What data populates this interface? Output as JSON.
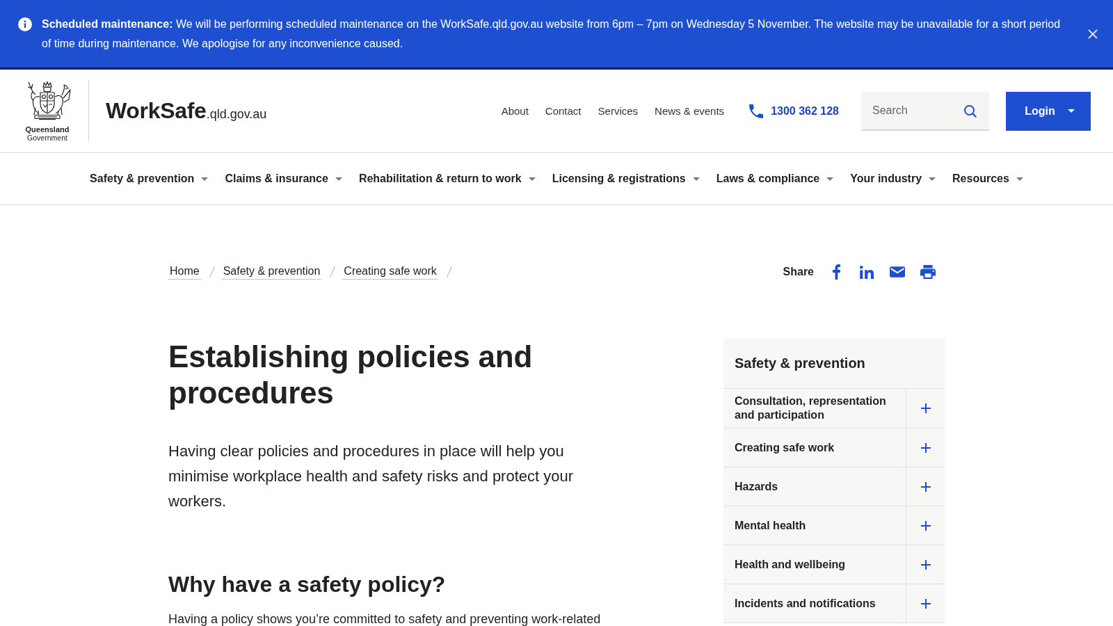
{
  "alert": {
    "message": "**Scheduled maintenance:** We will be performing scheduled maintenance on the WorkSafe.qld.gov.au website from 6pm – 7pm on Wednesday 5 November. The website may be unavailable for a short period of time during maintenance. We apologise for any inconvenience caused."
  },
  "header": {
    "logo": {
      "line_1": "Queensland",
      "line_2": "Government"
    },
    "site_name": {
      "name": "WorkSafe",
      "domain": ".qld.gov.au"
    },
    "links": [
      "About",
      "Contact",
      "Services",
      "News & events"
    ],
    "phone": "1300 362 128",
    "search": {
      "placeholder": "Search"
    },
    "login": {
      "label": "Login"
    }
  },
  "main_nav": [
    "Safety & prevention",
    "Claims & insurance",
    "Rehabilitation & return to work",
    "Licensing & registrations",
    "Laws & compliance",
    "Your industry",
    "Resources"
  ],
  "breadcrumb": [
    "Home",
    "Safety & prevention",
    "Creating safe work"
  ],
  "share": {
    "label": "Share"
  },
  "article": {
    "title": "Establishing policies and procedures",
    "lead": "Having clear policies and procedures in place will help you minimise workplace health and safety risks and protect your workers.",
    "sections": [
      {
        "heading": "Why have a safety policy?",
        "text": "Having a policy shows you’re committed to safety and preventing work-related"
      }
    ]
  },
  "sidebar": {
    "title": "Safety & prevention",
    "items": [
      {
        "label": "Consultation, representation and participation",
        "expanded": false
      },
      {
        "label": "Creating safe work",
        "expanded": false
      },
      {
        "label": "Hazards",
        "expanded": false
      },
      {
        "label": "Mental health",
        "expanded": false
      },
      {
        "label": "Health and wellbeing",
        "expanded": false
      },
      {
        "label": "Incidents and notifications",
        "expanded": false
      }
    ]
  }
}
